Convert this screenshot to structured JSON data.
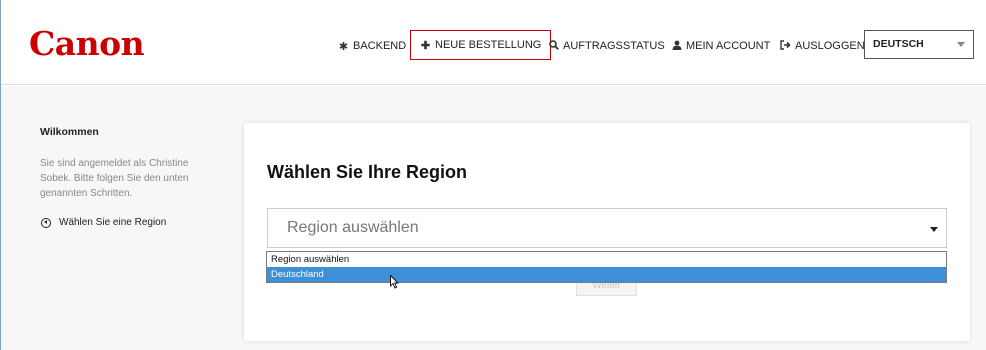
{
  "header": {
    "logo": "Canon",
    "nav": {
      "backend": "BACKEND",
      "new_order": "NEUE BESTELLUNG",
      "order_status": "AUFTRAGSSTATUS",
      "my_account": "MEIN ACCOUNT",
      "logout": "AUSLOGGEN"
    },
    "language_select": {
      "value": "DEUTSCH"
    }
  },
  "sidebar": {
    "title": "Wilkommen",
    "text": "Sie sind angemeldet als Christine Sobek. Bitte folgen Sie den unten genannten Schritten.",
    "steps": [
      {
        "label": "Wählen Sie eine Region"
      }
    ]
  },
  "main": {
    "title": "Wählen Sie Ihre Region",
    "region_select": {
      "placeholder": "Region auswählen"
    },
    "dropdown_options": [
      {
        "label": "Region auswählen",
        "selected": false
      },
      {
        "label": "Deutschland",
        "selected": true
      }
    ],
    "next_button": "Weiter"
  },
  "colors": {
    "brand": "#cc0000",
    "highlight": "#3d8fd6"
  },
  "icons": {
    "backend": "asterisk-icon",
    "new_order": "plus-icon",
    "order_status": "search-icon",
    "my_account": "user-icon",
    "logout": "sign-out-icon",
    "step": "circle-arrow-left-icon"
  }
}
